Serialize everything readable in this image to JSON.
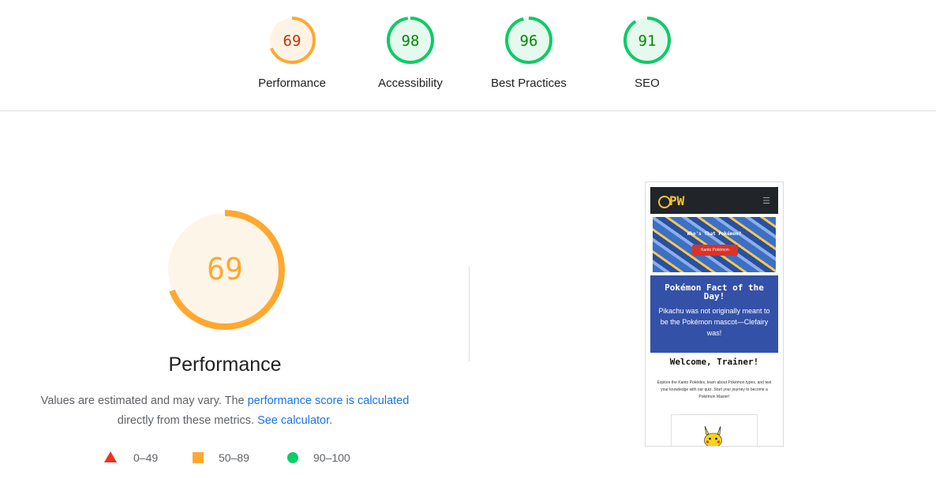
{
  "gauges": [
    {
      "name": "performance",
      "score": 69,
      "label": "Performance",
      "color": "#ffa830",
      "text_color": "#c33300",
      "bg": "#fff3e6"
    },
    {
      "name": "accessibility",
      "score": 98,
      "label": "Accessibility",
      "color": "#0ccc66",
      "text_color": "#008800",
      "bg": "#e6f9ee"
    },
    {
      "name": "best-practices",
      "score": 96,
      "label": "Best Practices",
      "color": "#0ccc66",
      "text_color": "#008800",
      "bg": "#e6f9ee"
    },
    {
      "name": "seo",
      "score": 91,
      "label": "SEO",
      "color": "#0ccc66",
      "text_color": "#008800",
      "bg": "#e6f9ee"
    }
  ],
  "main": {
    "score": 69,
    "title": "Performance",
    "desc_prefix": "Values are estimated and may vary. The ",
    "desc_link1": "performance score is calculated",
    "desc_mid": " directly from these metrics. ",
    "desc_link2": "See calculator",
    "desc_suffix": ".",
    "color": "#ffa830",
    "bg": "#fef5e9"
  },
  "legend": [
    {
      "shape": "triangle",
      "range": "0–49",
      "color": "#eb3323"
    },
    {
      "shape": "square",
      "range": "50–89",
      "color": "#ffa830"
    },
    {
      "shape": "circle",
      "range": "90–100",
      "color": "#0ccc66"
    }
  ],
  "thumbnail": {
    "logo": "PW",
    "hero_title": "Who's That Pokémon?",
    "hero_button": "Kanto Pokémon",
    "fact_title": "Pokémon Fact of the Day!",
    "fact_body": "Pikachu was not originally meant to be the Pokémon mascot—Clefairy was!",
    "welcome_title": "Welcome, Trainer!",
    "welcome_body": "Explore the Kanto Pokédex, learn about Pokémon types, and test your knowledge with our quiz. Start your journey to become a Pokémon Master!"
  }
}
